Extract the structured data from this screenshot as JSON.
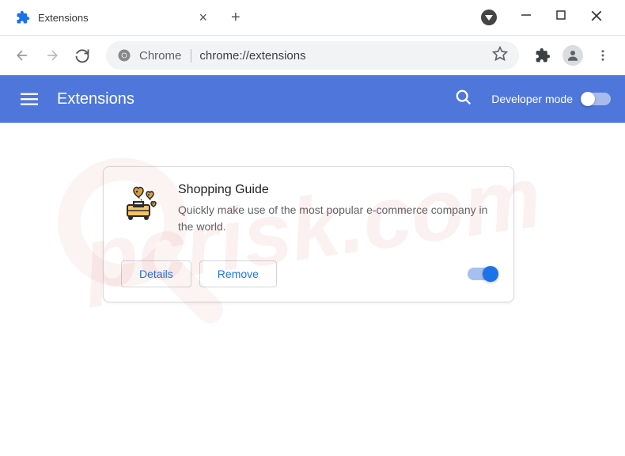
{
  "tab": {
    "title": "Extensions"
  },
  "url": {
    "scheme": "Chrome",
    "path": "chrome://extensions"
  },
  "header": {
    "title": "Extensions",
    "dev_mode_label": "Developer mode"
  },
  "extension": {
    "name": "Shopping Guide",
    "description": "Quickly make use of the most popular e-commerce company in the world.",
    "details_label": "Details",
    "remove_label": "Remove"
  },
  "watermark": "pcrisk.com"
}
